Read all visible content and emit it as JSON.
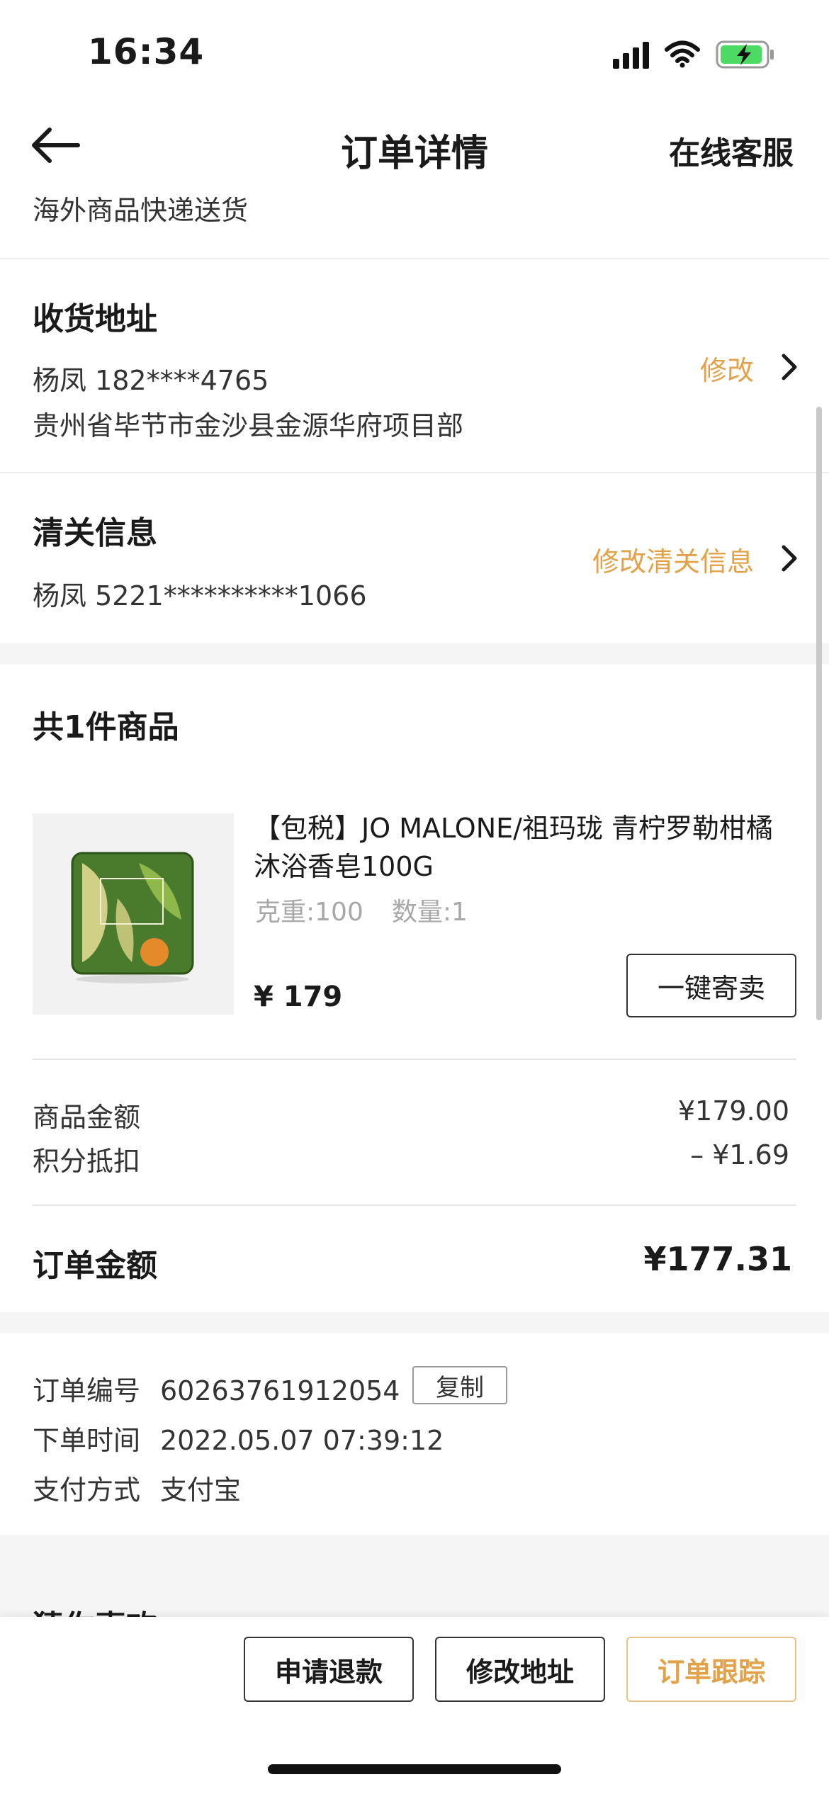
{
  "status_bar": {
    "time": "16:34"
  },
  "nav": {
    "title": "订单详情",
    "service_label": "在线客服"
  },
  "shipping_note": "海外商品快递送货",
  "address": {
    "title": "收货地址",
    "name_phone": "杨凤 182****4765",
    "detail": "贵州省毕节市金沙县金源华府项目部",
    "edit_label": "修改"
  },
  "customs": {
    "title": "清关信息",
    "name_id": "杨凤 5221**********1066",
    "edit_label": "修改清关信息"
  },
  "goods": {
    "count_title": "共1件商品",
    "product": {
      "title": "【包税】JO MALONE/祖玛珑 青柠罗勒柑橘沐浴香皂100G",
      "weight": "克重:100",
      "quantity": "数量:1",
      "price": "¥ 179",
      "resell_label": "一键寄卖"
    }
  },
  "summary": {
    "goods_amount_label": "商品金额",
    "goods_amount_value": "¥179.00",
    "points_label": "积分抵扣",
    "points_value": "– ¥1.69",
    "total_label": "订单金额",
    "total_value": "¥177.31"
  },
  "order_info": {
    "number_label": "订单编号",
    "number_value": "60263761912054",
    "copy_label": "复制",
    "time_label": "下单时间",
    "time_value": "2022.05.07 07:39:12",
    "payment_label": "支付方式",
    "payment_value": "支付宝"
  },
  "recommend": {
    "title": "猜你喜欢"
  },
  "actions": {
    "refund_label": "申请退款",
    "address_label": "修改地址",
    "track_label": "订单跟踪"
  },
  "colors": {
    "accent": "#e2a24a",
    "track_border": "#e9c488",
    "band": "#f5f5f5"
  },
  "battery": {
    "charging": true,
    "level": 0.8
  }
}
